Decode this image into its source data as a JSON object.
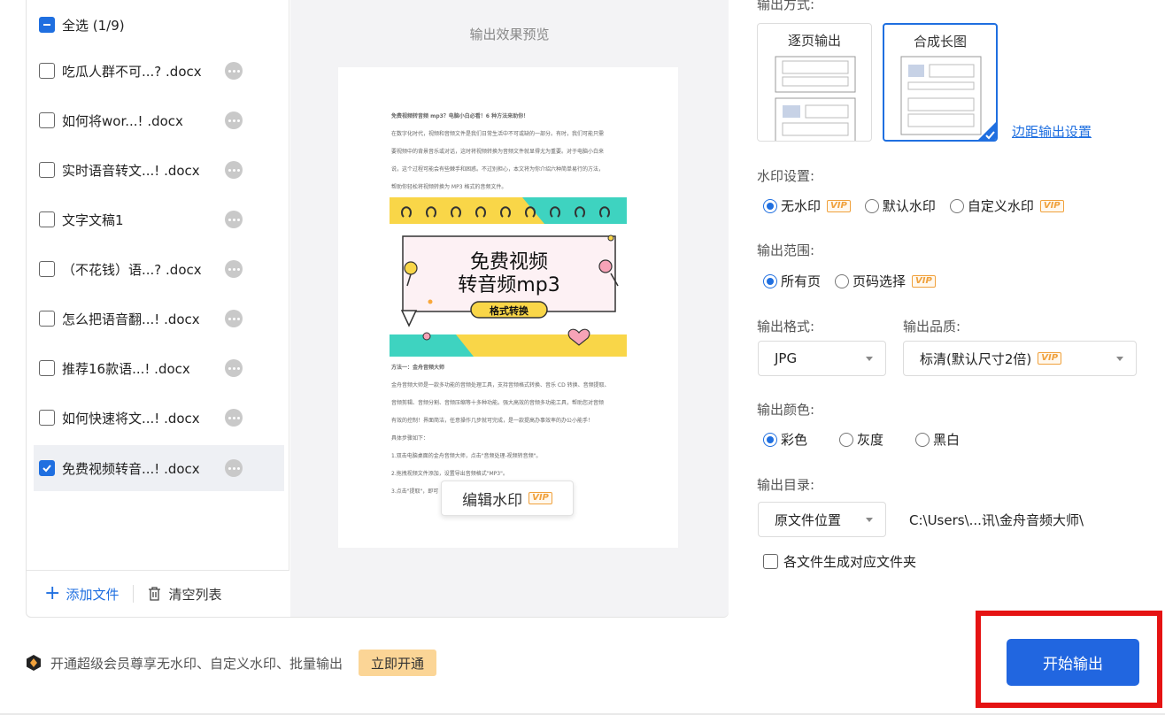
{
  "file_list": {
    "select_all_label": "全选 (1/9)",
    "files": [
      {
        "name": "吃瓜人群不可...? .docx",
        "checked": false
      },
      {
        "name": "如何将wor...! .docx",
        "checked": false
      },
      {
        "name": "实时语音转文...! .docx",
        "checked": false
      },
      {
        "name": "文字文稿1",
        "checked": false
      },
      {
        "name": "（不花钱）语...? .docx",
        "checked": false
      },
      {
        "name": "怎么把语音翻...! .docx",
        "checked": false
      },
      {
        "name": "推荐16款语...! .docx",
        "checked": false
      },
      {
        "name": "如何快速将文...! .docx",
        "checked": false
      },
      {
        "name": "免费视频转音...! .docx",
        "checked": true
      }
    ],
    "add_file_label": "添加文件",
    "clear_list_label": "清空列表"
  },
  "preview": {
    "title": "输出效果预览",
    "doc_lines_top": [
      "免费视频转音频 mp3？电脑小白必看！6 种方法来助你！",
      "在数字化时代，视频和音频文件是我们日常生活中不可或缺的一部分。有时，我们可能只需",
      "要视频中的背景音乐或对话，这时将视频转换为音频文件就显得尤为重要。对于电脑小白来",
      "说，这个过程可能会有些棘手和困惑。不过别担心，本文将为你介绍六种简单易行的方法，",
      "帮助你轻松将视频转换为 MP3 格式的音频文件。"
    ],
    "art_title_line1": "免费视频",
    "art_title_line2": "转音频mp3",
    "art_tag": "格式转换",
    "doc_lines_bottom": [
      "方法一：金舟音频大师",
      "金舟音频大师是一款多功能的音频处理工具，支持音频格式转换、音乐 CD 转换、音频提取、",
      "音频剪辑、音频分割、音频压缩等十多种功能。强大高效的音频多功能工具，帮助您对音频",
      "有效的控制！界面简洁，任意操作几步就可完成，是一款提高办事效率的办公小能手！",
      "具体步骤如下：",
      "1.双击电脑桌面的金舟音频大师，点击\"音频处理-视频转音频\"。",
      "2.拖拽视频文件添加，设置导出音频格式\"MP3\"。",
      "3.点击\"提取\"，即可"
    ],
    "watermark_button_label": "编辑水印"
  },
  "settings": {
    "output_mode_label": "输出方式:",
    "mode_page": "逐页输出",
    "mode_long": "合成长图",
    "margin_link": "边距输出设置",
    "watermark_label": "水印设置:",
    "watermark_options": [
      "无水印",
      "默认水印",
      "自定义水印"
    ],
    "range_label": "输出范围:",
    "range_options": [
      "所有页",
      "页码选择"
    ],
    "format_label": "输出格式:",
    "format_value": "JPG",
    "quality_label": "输出品质:",
    "quality_value": "标清(默认尺寸2倍)",
    "color_label": "输出颜色:",
    "color_options": [
      "彩色",
      "灰度",
      "黑白"
    ],
    "dir_label": "输出目录:",
    "dir_value": "原文件位置",
    "dir_path": "C:\\Users\\...讯\\金舟音频大师\\",
    "folder_checkbox": "各文件生成对应文件夹",
    "vip": "VIP"
  },
  "footer": {
    "promo_text": "开通超级会员尊享无水印、自定义水印、批量输出",
    "open_button": "立即开通",
    "start_button": "开始输出"
  },
  "colors": {
    "accent": "#2166e0",
    "highlight": "#e51313",
    "vip": "#f0a13c"
  }
}
